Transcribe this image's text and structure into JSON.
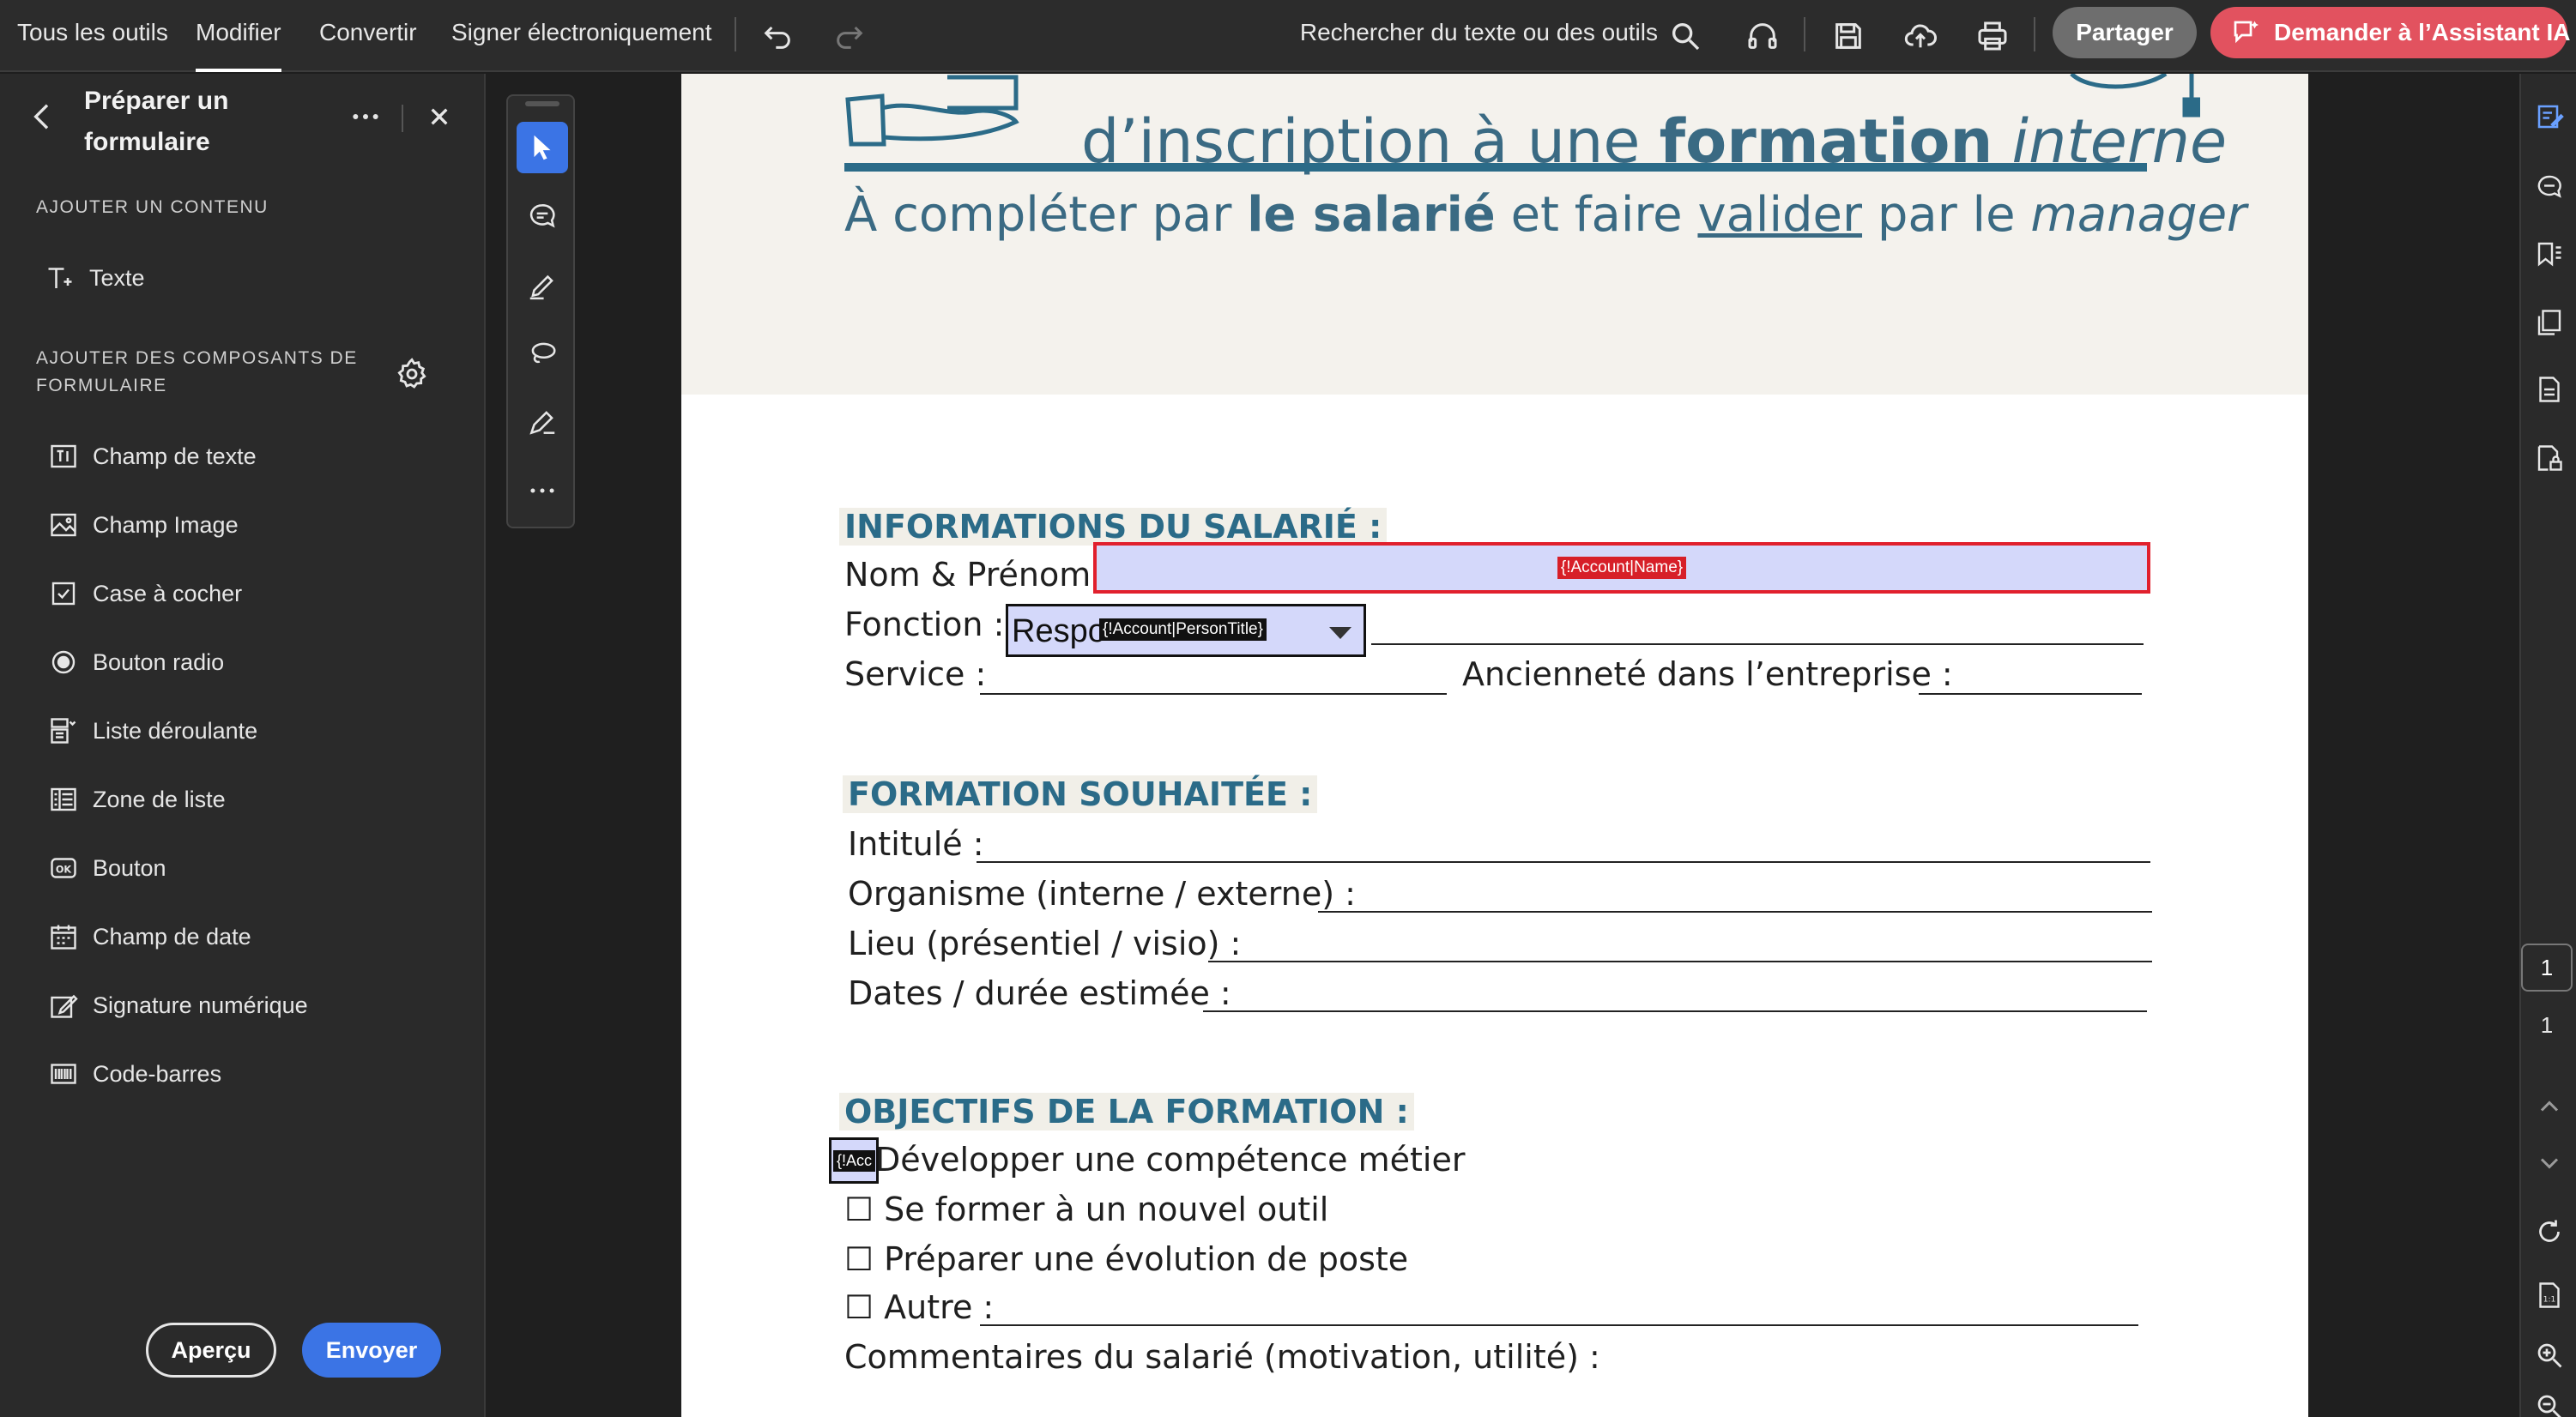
{
  "topbar": {
    "menu": [
      "Tous les outils",
      "Modifier",
      "Convertir",
      "Signer électroniquement"
    ],
    "active_menu": "Modifier",
    "search_label": "Rechercher du texte ou des outils",
    "share_label": "Partager",
    "ai_label": "Demander à l’Assistant IA",
    "colors": {
      "share": "#6e6e6e",
      "ai": "#e2525f"
    }
  },
  "panel": {
    "title": "Préparer un formulaire",
    "section_content": "AJOUTER UN CONTENU",
    "text_tool": "Texte",
    "section_components": "AJOUTER DES COMPOSANTS DE FORMULAIRE",
    "tools": [
      "Champ de texte",
      "Champ Image",
      "Case à cocher",
      "Bouton radio",
      "Liste déroulante",
      "Zone de liste",
      "Bouton",
      "Champ de date",
      "Signature numérique",
      "Code-barres"
    ],
    "preview_label": "Aperçu",
    "send_label": "Envoyer",
    "colors": {
      "send": "#3b74e5"
    }
  },
  "document": {
    "title_part1": "d’inscription à une ",
    "title_bold": "formation",
    "title_italic": " interne",
    "subtitle_part1": "À compléter par ",
    "subtitle_bold": "le salarié",
    "subtitle_part2": " et faire ",
    "subtitle_underline": "valider",
    "subtitle_part3": " par le ",
    "subtitle_italic": "manager",
    "section1": "INFORMATIONS DU SALARIÉ :",
    "nom_label": "Nom & Prénom :",
    "nom_field_tag": "{!Account|Name}",
    "fonction_label": "Fonction :",
    "fonction_value": "Respo",
    "fonction_field_tag": "{!Account|PersonTitle}",
    "service_label": "Service :",
    "anciennete_label": "Ancienneté dans l’entreprise :",
    "section2": "FORMATION SOUHAITÉE :",
    "intitule_label": "Intitulé :",
    "organisme_label": "Organisme (interne / externe) :",
    "lieu_label": "Lieu (présentiel / visio) :",
    "dates_label": "Dates / durée estimée :",
    "section3": "OBJECTIFS DE LA FORMATION :",
    "checkbox_tag": "{!Acc",
    "objective1": "Développer une compétence métier",
    "objective2": "Se former à un nouvel outil",
    "objective3": "Préparer une évolution de poste",
    "objective4": "Autre :",
    "checkbox_glyph": "☐",
    "comments_label": "Commentaires du salarié (motivation, utilité) :",
    "colors": {
      "heading": "#2b6b88",
      "field_fill": "#d4d8fa",
      "field_border": "#e1202d"
    }
  },
  "pager": {
    "current": "1",
    "total": "1"
  }
}
